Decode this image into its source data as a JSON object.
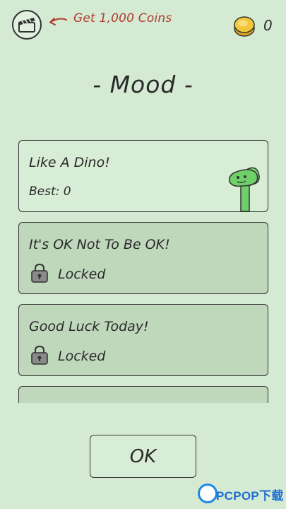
{
  "header": {
    "reward_text": "Get 1,000 Coins",
    "coins": "0"
  },
  "page": {
    "title": "- Mood -"
  },
  "cards": [
    {
      "title": "Like A Dino!",
      "subtitle": "Best: 0",
      "status": "unlocked",
      "icon": "dino-icon"
    },
    {
      "title": "It's OK Not To Be OK!",
      "status_label": "Locked",
      "status": "locked",
      "icon": "lock-icon"
    },
    {
      "title": "Good Luck Today!",
      "status_label": "Locked",
      "status": "locked",
      "icon": "lock-icon"
    }
  ],
  "footer": {
    "ok_label": "OK"
  },
  "watermark": {
    "brand": "PCPOP下载"
  },
  "colors": {
    "background": "#d5ead2",
    "card_unlocked": "#d8edd5",
    "card_locked": "#bfd8bc",
    "reward_text": "#b03a2e",
    "coin": "#f3c73a",
    "dino": "#6fcf6a"
  }
}
